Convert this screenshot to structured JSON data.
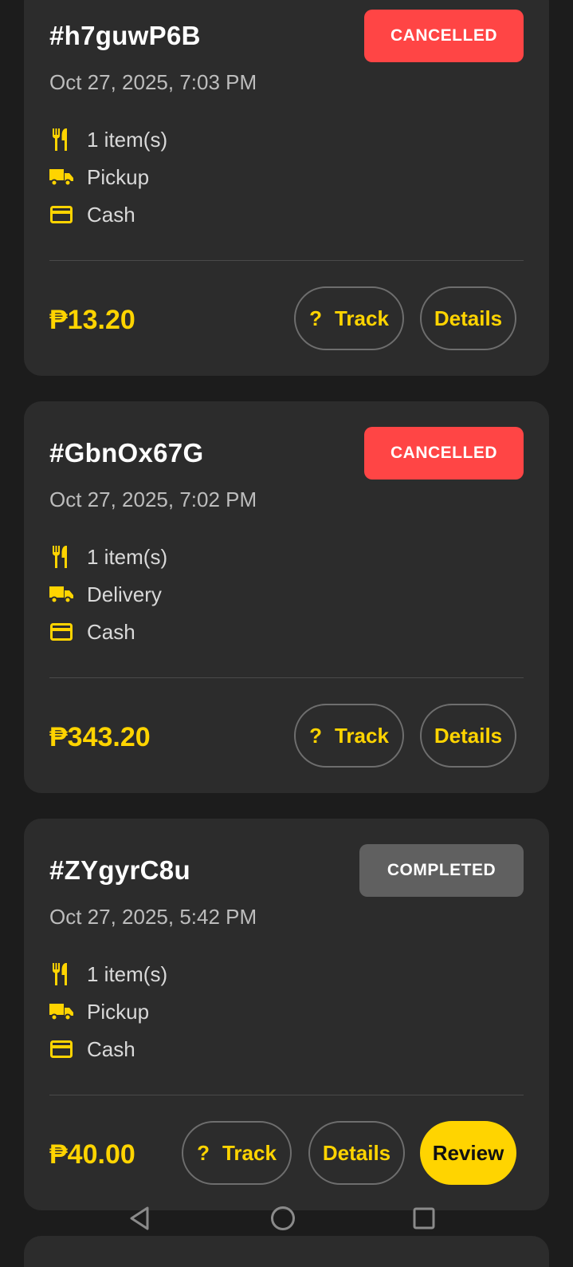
{
  "currency": "₱",
  "labels": {
    "track": "Track",
    "details": "Details",
    "review": "Review",
    "track_prefix_icon": "?"
  },
  "colors": {
    "accent": "#ffd400",
    "cancelled": "#ff4545",
    "completed": "#606060",
    "card": "#2c2c2c",
    "background": "#1c1c1c"
  },
  "orders": [
    {
      "id": "#h7guwP6B",
      "status": "CANCELLED",
      "date": "Oct 27, 2025, 7:03 PM",
      "items": "1 item(s)",
      "fulfillment": "Pickup",
      "payment": "Cash",
      "total": "₱13.20"
    },
    {
      "id": "#GbnOx67G",
      "status": "CANCELLED",
      "date": "Oct 27, 2025, 7:02 PM",
      "items": "1 item(s)",
      "fulfillment": "Delivery",
      "payment": "Cash",
      "total": "₱343.20"
    },
    {
      "id": "#ZYgyrC8u",
      "status": "COMPLETED",
      "date": "Oct 27, 2025, 5:42 PM",
      "items": "1 item(s)",
      "fulfillment": "Pickup",
      "payment": "Cash",
      "total": "₱40.00"
    }
  ],
  "icons": {
    "items": "utensils-icon",
    "fulfillment": "truck-icon",
    "payment": "credit-card-icon",
    "nav_back": "back-triangle-icon",
    "nav_home": "home-circle-icon",
    "nav_recent": "recents-square-icon"
  }
}
